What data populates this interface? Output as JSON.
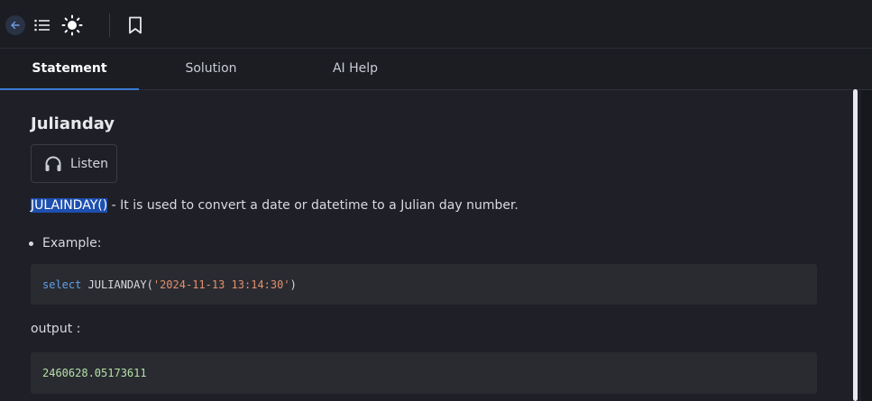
{
  "toolbar": {
    "icons": [
      "arrow-left-icon",
      "list-icon",
      "sun-icon",
      "bookmark-icon"
    ],
    "accent": "#3b7bd6"
  },
  "tabs": [
    {
      "label": "Statement",
      "active": true
    },
    {
      "label": "Solution",
      "active": false
    },
    {
      "label": "AI Help",
      "active": false
    }
  ],
  "content": {
    "title": "Julianday",
    "listen_label": "Listen",
    "desc_highlight": "JULAINDAY()",
    "desc_rest": " - It is used to convert a date or datetime to a Julian day number.",
    "bullet": "Example:",
    "code": {
      "keyword": "select",
      "fn": " JULIANDAY(",
      "string": "'2024-11-13 13:14:30'",
      "close": ")"
    },
    "output_label": "output :",
    "output_value": "2460628.05173611"
  }
}
